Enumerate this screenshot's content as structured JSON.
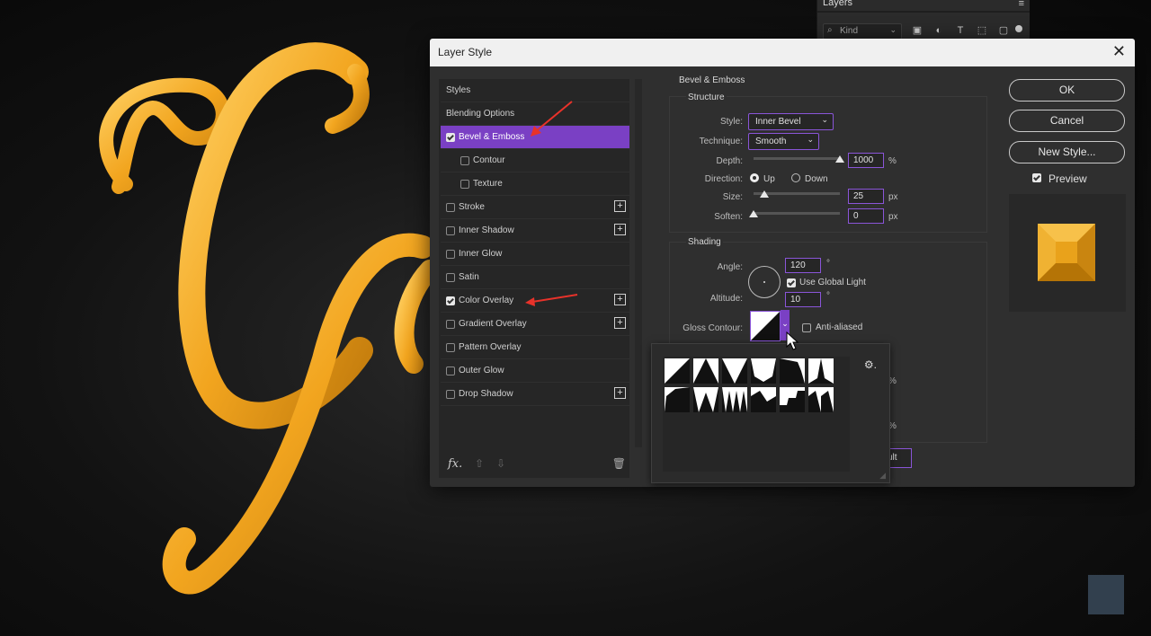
{
  "layers_panel": {
    "tab": "Layers",
    "menu_glyph": "≡",
    "filter_kind": "Kind",
    "filter_icons": [
      "image-filter-icon",
      "adjustment-filter-icon",
      "type-filter-icon",
      "shape-filter-icon",
      "smart-object-filter-icon"
    ]
  },
  "dialog": {
    "title": "Layer Style",
    "close_glyph": "✕"
  },
  "styles_list": {
    "items": [
      {
        "label": "Styles",
        "checked": null,
        "selected": false,
        "indent": 0,
        "plus": false
      },
      {
        "label": "Blending Options",
        "checked": null,
        "selected": false,
        "indent": 0,
        "plus": false
      },
      {
        "label": "Bevel & Emboss",
        "checked": true,
        "selected": true,
        "indent": 0,
        "plus": false
      },
      {
        "label": "Contour",
        "checked": false,
        "selected": false,
        "indent": 1,
        "plus": false
      },
      {
        "label": "Texture",
        "checked": false,
        "selected": false,
        "indent": 1,
        "plus": false
      },
      {
        "label": "Stroke",
        "checked": false,
        "selected": false,
        "indent": 0,
        "plus": true
      },
      {
        "label": "Inner Shadow",
        "checked": false,
        "selected": false,
        "indent": 0,
        "plus": true
      },
      {
        "label": "Inner Glow",
        "checked": false,
        "selected": false,
        "indent": 0,
        "plus": false
      },
      {
        "label": "Satin",
        "checked": false,
        "selected": false,
        "indent": 0,
        "plus": false
      },
      {
        "label": "Color Overlay",
        "checked": true,
        "selected": false,
        "indent": 0,
        "plus": true
      },
      {
        "label": "Gradient Overlay",
        "checked": false,
        "selected": false,
        "indent": 0,
        "plus": true
      },
      {
        "label": "Pattern Overlay",
        "checked": false,
        "selected": false,
        "indent": 0,
        "plus": false
      },
      {
        "label": "Outer Glow",
        "checked": false,
        "selected": false,
        "indent": 0,
        "plus": false
      },
      {
        "label": "Drop Shadow",
        "checked": false,
        "selected": false,
        "indent": 0,
        "plus": true
      }
    ],
    "footer": {
      "fx": "fx.",
      "up": "⇧",
      "down": "⇩",
      "trash": "🗑"
    }
  },
  "bevel": {
    "heading": "Bevel & Emboss",
    "structure": {
      "heading": "Structure",
      "style_label": "Style:",
      "style_value": "Inner Bevel",
      "technique_label": "Technique:",
      "technique_value": "Smooth",
      "depth_label": "Depth:",
      "depth_value": "1000",
      "depth_unit": "%",
      "depth_fraction": 1.0,
      "direction_label": "Direction:",
      "direction_up": "Up",
      "direction_down": "Down",
      "direction_selected": "Up",
      "size_label": "Size:",
      "size_value": "25",
      "size_unit": "px",
      "size_fraction": 0.13,
      "soften_label": "Soften:",
      "soften_value": "0",
      "soften_unit": "px",
      "soften_fraction": 0.0
    },
    "shading": {
      "heading": "Shading",
      "angle_label": "Angle:",
      "angle_value": "120",
      "angle_unit": "°",
      "global_light_label": "Use Global Light",
      "global_light_checked": true,
      "altitude_label": "Altitude:",
      "altitude_value": "10",
      "altitude_unit": "°",
      "gloss_label": "Gloss Contour:",
      "anti_aliased_label": "Anti-aliased",
      "anti_aliased_checked": false,
      "hidden_unit_1": "%",
      "hidden_unit_2": "%",
      "hidden_button_fragment": "ult"
    }
  },
  "contour_picker": {
    "presets": [
      "linear",
      "cone",
      "cone-inverted",
      "cove-deep",
      "cove-shallow",
      "gaussian",
      "half-round",
      "ring",
      "ring-double",
      "rolling-slope",
      "rounded-steps",
      "sawtooth"
    ],
    "gear_glyph": "⚙."
  },
  "buttons": {
    "ok": "OK",
    "cancel": "Cancel",
    "new_style": "New Style...",
    "preview_label": "Preview",
    "preview_checked": true
  },
  "colors": {
    "accent": "#7a40c4",
    "gold": "#e9a21b",
    "annotation_arrow": "#e8322a"
  }
}
